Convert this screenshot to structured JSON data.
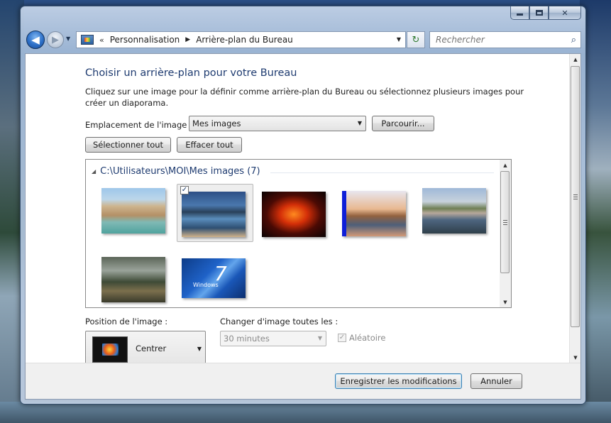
{
  "navigation": {
    "breadcrumb": [
      "Personnalisation",
      "Arrière-plan du Bureau"
    ],
    "overflow_chevron": "«",
    "search_placeholder": "Rechercher"
  },
  "page": {
    "title": "Choisir un arrière-plan pour votre Bureau",
    "description": "Cliquez sur une image pour la définir comme arrière-plan du Bureau ou sélectionnez plusieurs images pour créer un diaporama."
  },
  "location": {
    "label": "Emplacement de l'image :",
    "selected": "Mes images",
    "browse_label": "Parcourir..."
  },
  "buttons": {
    "select_all": "Sélectionner tout",
    "clear_all": "Effacer tout",
    "save": "Enregistrer les modifications",
    "cancel": "Annuler"
  },
  "gallery": {
    "group_header": "C:\\Utilisateurs\\MOI\\Mes images (7)",
    "images": [
      {
        "subject": "sea-arch",
        "selected": false
      },
      {
        "subject": "mountain-lake",
        "selected": true
      },
      {
        "subject": "fire-horse",
        "selected": false
      },
      {
        "subject": "harbor-boats",
        "selected": false
      },
      {
        "subject": "lakeside-village",
        "selected": false
      },
      {
        "subject": "forest-valley",
        "selected": false
      },
      {
        "subject": "windows-7",
        "selected": false,
        "caption": "Windows",
        "number": "7"
      }
    ]
  },
  "position": {
    "label": "Position de l'image :",
    "selected": "Centrer"
  },
  "interval": {
    "label": "Changer d'image toutes les :",
    "selected": "30 minutes",
    "enabled": false
  },
  "shuffle": {
    "label": "Aléatoire",
    "checked": true,
    "enabled": false
  },
  "icons": {
    "back": "◀",
    "forward": "▶",
    "refresh": "↻",
    "search": "⌕",
    "check": "✓",
    "dropdown": "▼",
    "collapse": "◢"
  },
  "colors": {
    "title": "#1e3b70",
    "accent": "#3c7fb1"
  }
}
